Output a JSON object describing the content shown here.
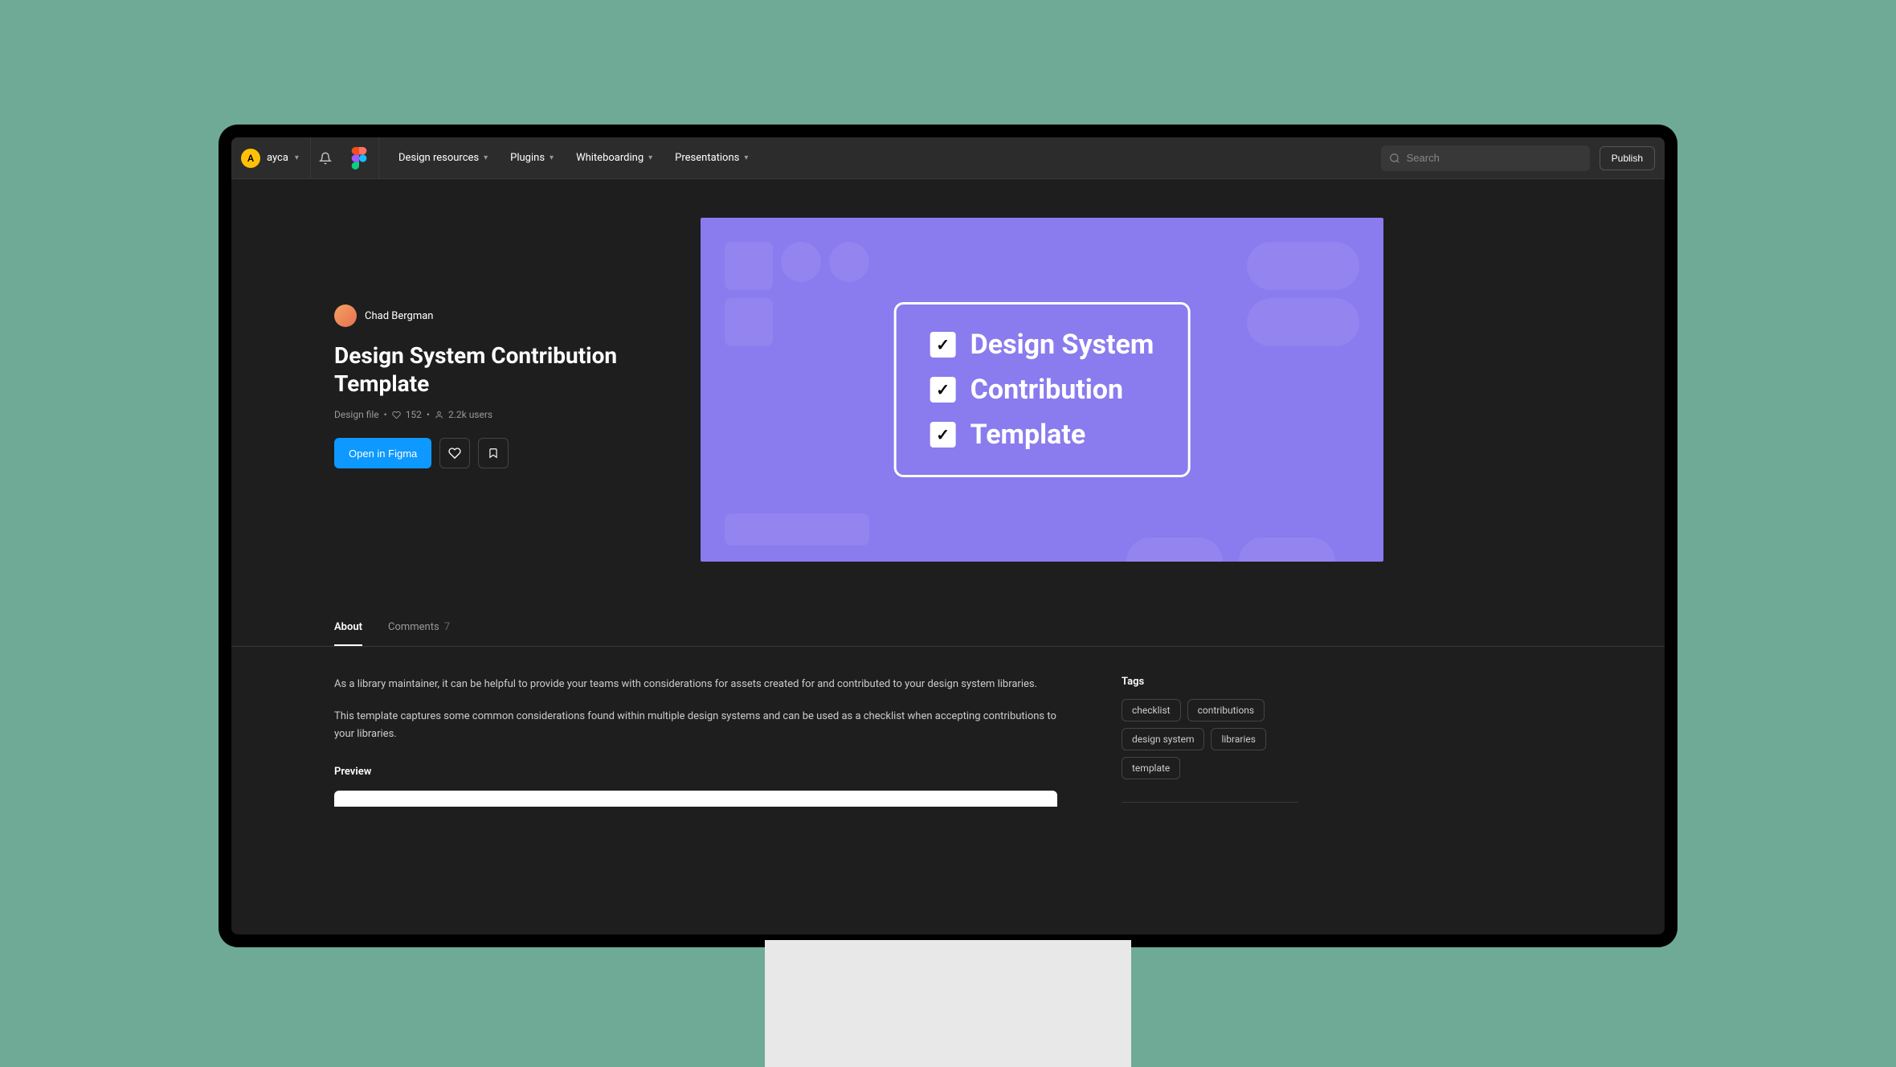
{
  "nav": {
    "avatar_initial": "A",
    "username": "ayca",
    "links": [
      "Design resources",
      "Plugins",
      "Whiteboarding",
      "Presentations"
    ],
    "search_placeholder": "Search",
    "publish_label": "Publish"
  },
  "resource": {
    "author": "Chad Bergman",
    "title": "Design System Contribution Template",
    "file_type": "Design file",
    "likes": "152",
    "users": "2.2k users",
    "open_label": "Open in Figma",
    "cover_lines": [
      "Design System",
      "Contribution",
      "Template"
    ]
  },
  "tabs": {
    "about": "About",
    "comments": "Comments",
    "comments_count": "7"
  },
  "description": {
    "p1": "As a library maintainer, it can be helpful to provide your teams with considerations for assets created for and contributed to your design system libraries.",
    "p2": "This template captures some common considerations found within multiple design systems and can be used as a checklist when accepting contributions to your libraries.",
    "preview_heading": "Preview"
  },
  "sidebar": {
    "tags_heading": "Tags",
    "tags": [
      "checklist",
      "contributions",
      "design system",
      "libraries",
      "template"
    ]
  }
}
